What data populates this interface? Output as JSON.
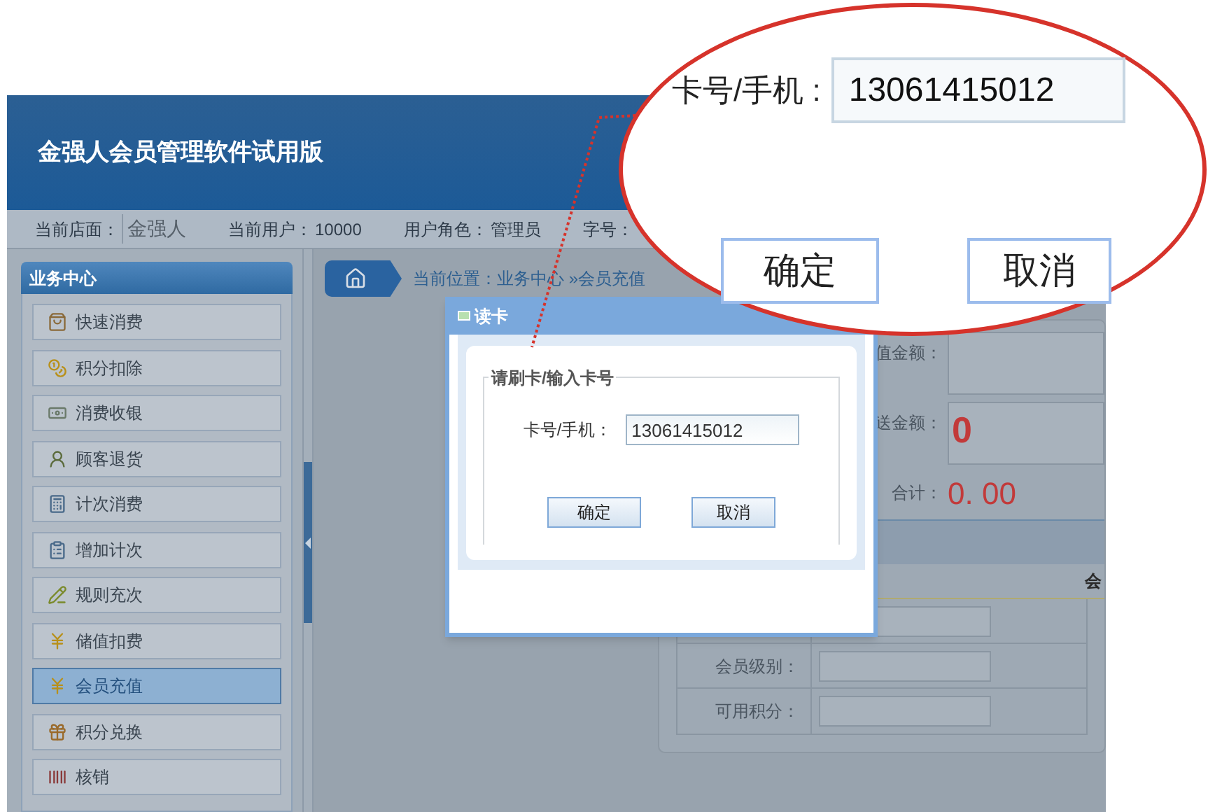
{
  "header": {
    "title": "金强人会员管理软件试用版"
  },
  "info_bar": [
    {
      "label": "当前店面：",
      "value": "金强人"
    },
    {
      "label": "当前用户：",
      "value": "10000"
    },
    {
      "label": "用户角色：",
      "value": "管理员"
    },
    {
      "label": "字号："
    }
  ],
  "sidebar": {
    "title": "业务中心",
    "items": [
      {
        "label": "快速消费",
        "selected": false
      },
      {
        "label": "积分扣除",
        "selected": false
      },
      {
        "label": "消费收银",
        "selected": false
      },
      {
        "label": "顾客退货",
        "selected": false
      },
      {
        "label": "计次消费",
        "selected": false
      },
      {
        "label": "增加计次",
        "selected": false
      },
      {
        "label": "规则充次",
        "selected": false
      },
      {
        "label": "储值扣费",
        "selected": false
      },
      {
        "label": "会员充值",
        "selected": true
      },
      {
        "label": "积分兑换",
        "selected": false
      },
      {
        "label": "核销",
        "selected": false
      }
    ]
  },
  "breadcrumb": {
    "label": "当前位置：",
    "path": "业务中心 »会员充值"
  },
  "form": {
    "fields": [
      {
        "label": "值金额："
      },
      {
        "label": "送金额：",
        "value": "0"
      }
    ],
    "total": {
      "label": "合计：",
      "value": "0. 00"
    },
    "section_title": "会",
    "member_rows": [
      {
        "label": "会员级别："
      },
      {
        "label": "可用积分："
      }
    ]
  },
  "dialog": {
    "title": "读卡",
    "group_title": "请刷卡/输入卡号",
    "field": {
      "label": "卡号/手机：",
      "value": "13061415012"
    },
    "buttons": [
      "确定",
      "取消"
    ]
  },
  "callout": {
    "field": {
      "label": "卡号/手机 :",
      "value": "13061415012"
    },
    "buttons": [
      "确定",
      "取消"
    ]
  }
}
